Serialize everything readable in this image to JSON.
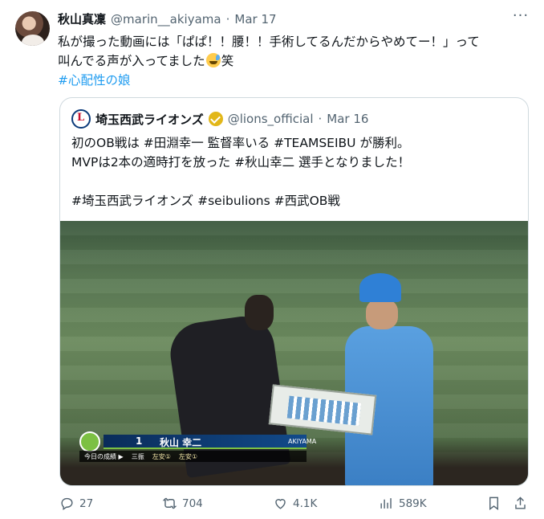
{
  "tweet": {
    "author_name": "秋山真凜",
    "author_handle": "@marin__akiyama",
    "separator": "·",
    "date": "Mar 17",
    "text_line1": "私が撮った動画には「ぱぱ！！腰！！手術してるんだからやめてー！」って",
    "text_line2_pre": "叫んでる声が入ってました",
    "text_line2_post": "笑",
    "emoji": "sweat-smile",
    "hashtag": "#心配性の娘"
  },
  "quoted": {
    "author_name": "埼玉西武ライオンズ",
    "author_handle": "@lions_official",
    "separator": "·",
    "date": "Mar 16",
    "line1": "初のOB戦は #田淵幸一 監督率いる #TEAMSEIBU が勝利。",
    "line2": "MVPは2本の適時打を放った #秋山幸二 選手となりました！",
    "line3": "",
    "line4": "#埼玉西武ライオンズ #seibulions #西武OB戦",
    "media": {
      "overlay_number": "1",
      "overlay_name": "秋山 幸二",
      "overlay_roman": "AKIYAMA",
      "overlay_label": "今日の成績 ▶",
      "overlay_r1": "三振",
      "overlay_r2": "左安①",
      "overlay_r3": "左安①"
    }
  },
  "actions": {
    "replies": "27",
    "reposts": "704",
    "likes": "4.1K",
    "views": "589K"
  },
  "colors": {
    "text": "#0f1419",
    "secondary": "#536471",
    "link": "#1d9bf0",
    "border": "#cfd9de",
    "verified_gold": "#e2b719"
  }
}
